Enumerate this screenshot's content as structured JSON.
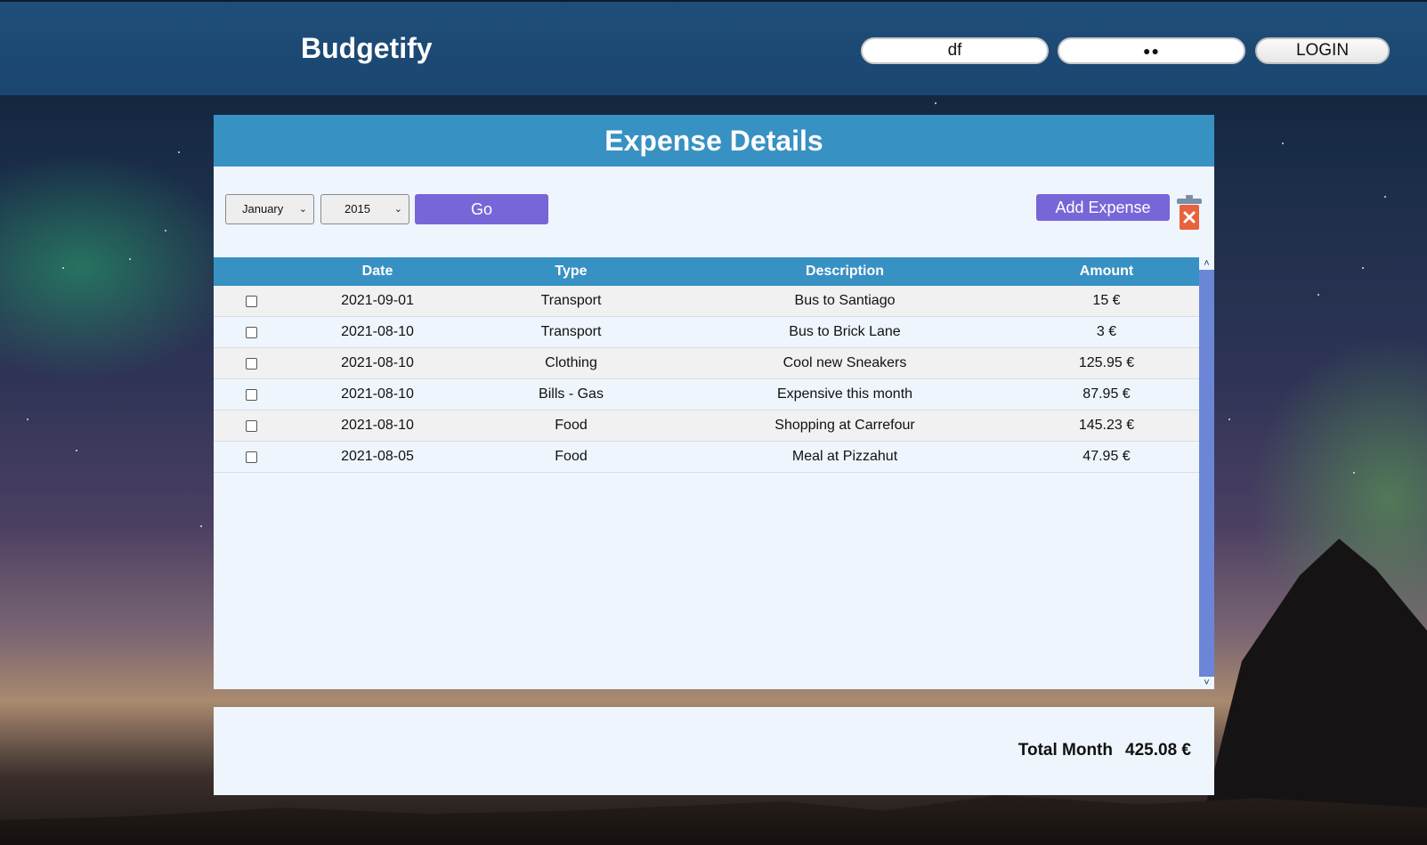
{
  "header": {
    "brand": "Budgetify",
    "username_value": "df",
    "password_value": "●●",
    "login_label": "LOGIN"
  },
  "panel": {
    "title": "Expense Details",
    "month_select": "January",
    "year_select": "2015",
    "go_label": "Go",
    "add_expense_label": "Add Expense"
  },
  "table": {
    "headers": {
      "date": "Date",
      "type": "Type",
      "description": "Description",
      "amount": "Amount"
    },
    "rows": [
      {
        "date": "2021-09-01",
        "type": "Transport",
        "description": "Bus to Santiago",
        "amount": "15 €"
      },
      {
        "date": "2021-08-10",
        "type": "Transport",
        "description": "Bus to Brick Lane",
        "amount": "3 €"
      },
      {
        "date": "2021-08-10",
        "type": "Clothing",
        "description": "Cool new Sneakers",
        "amount": "125.95 €"
      },
      {
        "date": "2021-08-10",
        "type": "Bills - Gas",
        "description": "Expensive this month",
        "amount": "87.95 €"
      },
      {
        "date": "2021-08-10",
        "type": "Food",
        "description": "Shopping at Carrefour",
        "amount": "145.23 €"
      },
      {
        "date": "2021-08-05",
        "type": "Food",
        "description": "Meal at Pizzahut",
        "amount": "47.95 €"
      }
    ]
  },
  "footer": {
    "total_label": "Total Month",
    "total_value": "425.08 €"
  },
  "colors": {
    "header_bar": "#1e4e79",
    "panel_header": "#3891c3",
    "button": "#7766d8",
    "trash_body": "#e8623f",
    "scrollbar": "#6b86d6"
  },
  "icons": {
    "trash": "trash-delete-icon",
    "select_arrow": "chevron-down-icon",
    "scroll_up": "chevron-up-icon",
    "scroll_down": "chevron-down-icon"
  }
}
